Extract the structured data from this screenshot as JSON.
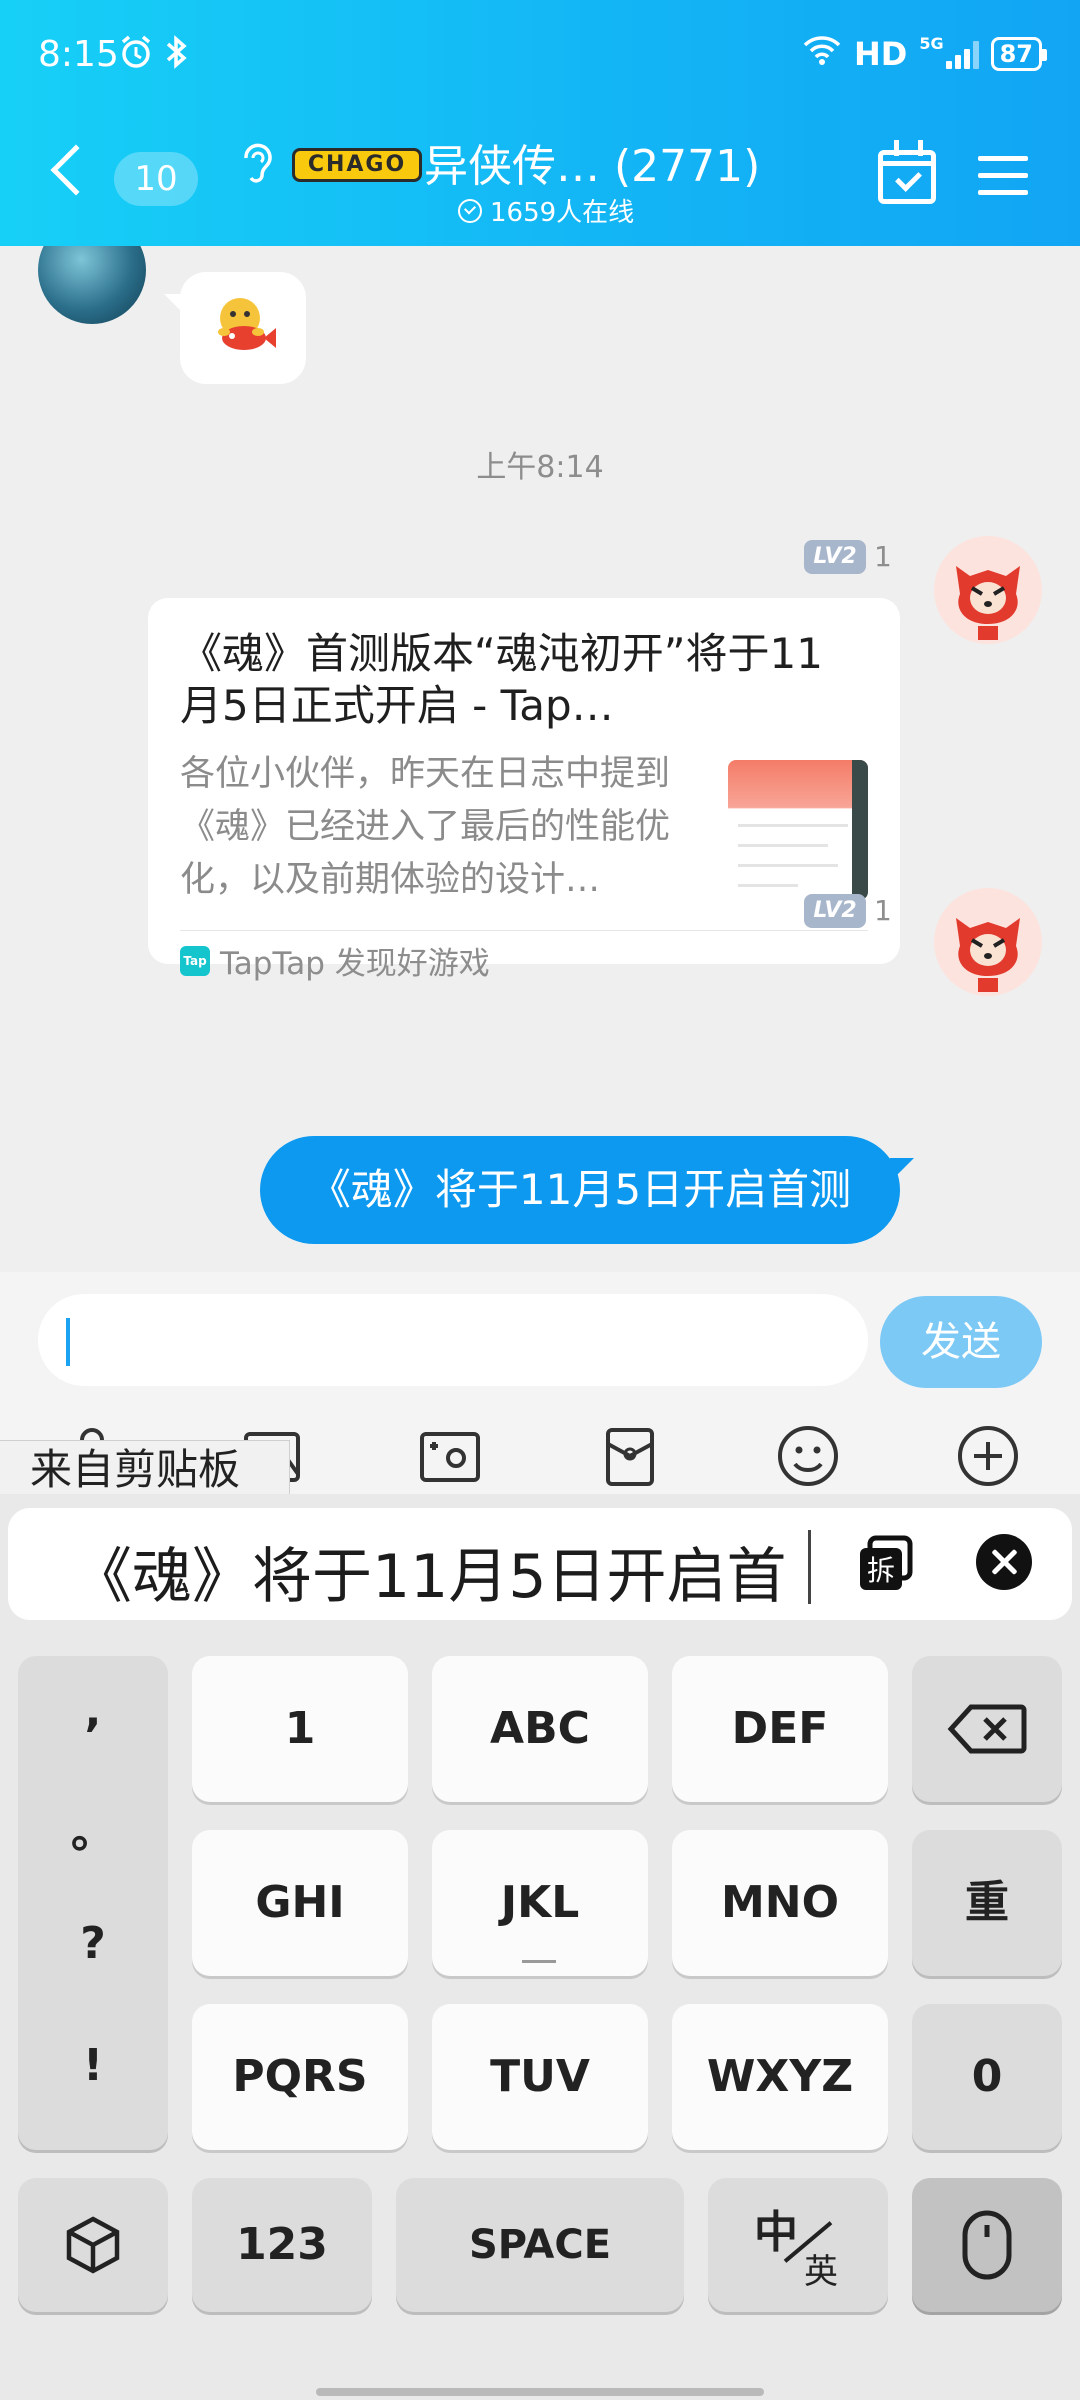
{
  "status_bar": {
    "time": "8:15",
    "network": "HD",
    "network_gen": "5G",
    "battery": "87"
  },
  "header": {
    "unread_count": "10",
    "logo_text": "CHAGO",
    "title": "异侠传…   (2771)",
    "online": "1659人在线"
  },
  "chat": {
    "timestamp": "上午8:14",
    "messages": [
      {
        "level": "LV2",
        "level_num": "1",
        "card": {
          "title": "《魂》首测版本“魂沌初开”将于11月5日正式开启 - Tap…",
          "description": "各位小伙伴，昨天在日志中提到《魂》已经进入了最后的性能优化，以及前期体验的设计…",
          "source": "TapTap 发现好游戏",
          "source_icon": "Tap"
        }
      },
      {
        "level": "LV2",
        "level_num": "1",
        "text": "《魂》将于11月5日开启首测"
      }
    ]
  },
  "input_bar": {
    "value": "",
    "send_label": "发送"
  },
  "clipboard": {
    "label": "来自剪贴板",
    "text": "《魂》将于11月5日开启首",
    "split_label": "拆"
  },
  "keyboard": {
    "punct": [
      ",",
      "。",
      "?",
      "!"
    ],
    "rows": [
      [
        "1",
        "ABC",
        "DEF"
      ],
      [
        "GHI",
        "JKL",
        "MNO"
      ],
      [
        "PQRS",
        "TUV",
        "WXYZ"
      ]
    ],
    "redo": "重",
    "zero": "0",
    "numbers": "123",
    "space": "SPACE",
    "lang_zh": "中",
    "lang_en": "英"
  },
  "colors": {
    "header_gradient_start": "#17d0f7",
    "header_gradient_end": "#12a5f4",
    "bubble_blue": "#0c99ef",
    "send_button": "#7cc9f6"
  }
}
